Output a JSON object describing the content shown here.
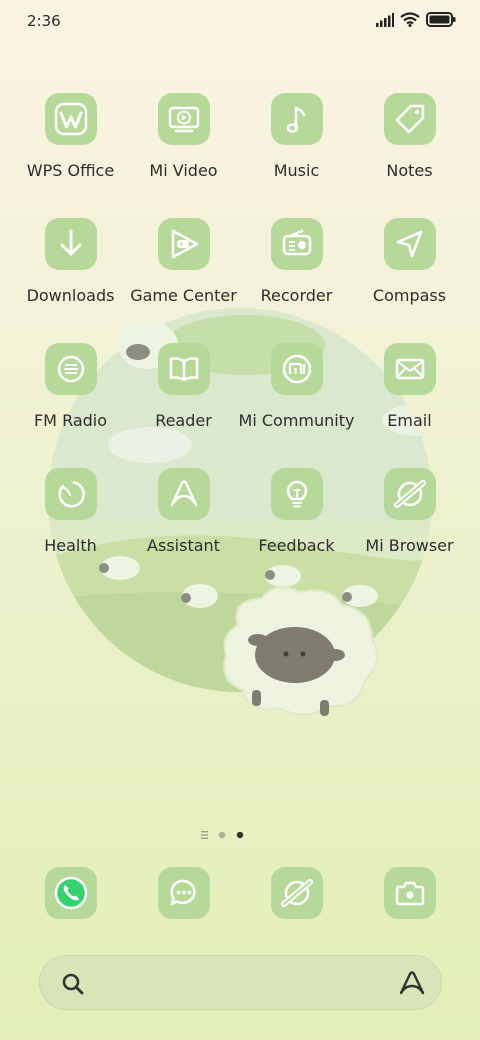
{
  "status_bar": {
    "time": "2:36"
  },
  "apps": [
    {
      "label": "WPS Office",
      "icon": "wps-office-icon"
    },
    {
      "label": "Mi Video",
      "icon": "mi-video-icon"
    },
    {
      "label": "Music",
      "icon": "music-note-icon"
    },
    {
      "label": "Notes",
      "icon": "tag-icon"
    },
    {
      "label": "Downloads",
      "icon": "download-arrow-icon"
    },
    {
      "label": "Game Center",
      "icon": "game-center-icon"
    },
    {
      "label": "Recorder",
      "icon": "radio-recorder-icon"
    },
    {
      "label": "Compass",
      "icon": "navigation-arrow-icon"
    },
    {
      "label": "FM Radio",
      "icon": "fm-radio-icon"
    },
    {
      "label": "Reader",
      "icon": "open-book-icon"
    },
    {
      "label": "Mi Community",
      "icon": "mi-logo-icon"
    },
    {
      "label": "Email",
      "icon": "envelope-icon"
    },
    {
      "label": "Health",
      "icon": "health-ring-icon"
    },
    {
      "label": "Assistant",
      "icon": "assistant-a-icon"
    },
    {
      "label": "Feedback",
      "icon": "lightbulb-icon"
    },
    {
      "label": "Mi Browser",
      "icon": "planet-browser-icon"
    }
  ],
  "dock": [
    {
      "icon": "phone-icon"
    },
    {
      "icon": "chat-bubble-icon"
    },
    {
      "icon": "planet-browser-icon"
    },
    {
      "icon": "camera-icon"
    }
  ],
  "page_indicator": {
    "pages": 3,
    "current": 3
  },
  "theme": {
    "tile_color": "#b6d99a",
    "icon_color": "#ffffff",
    "phone_accent": "#35d26f"
  }
}
